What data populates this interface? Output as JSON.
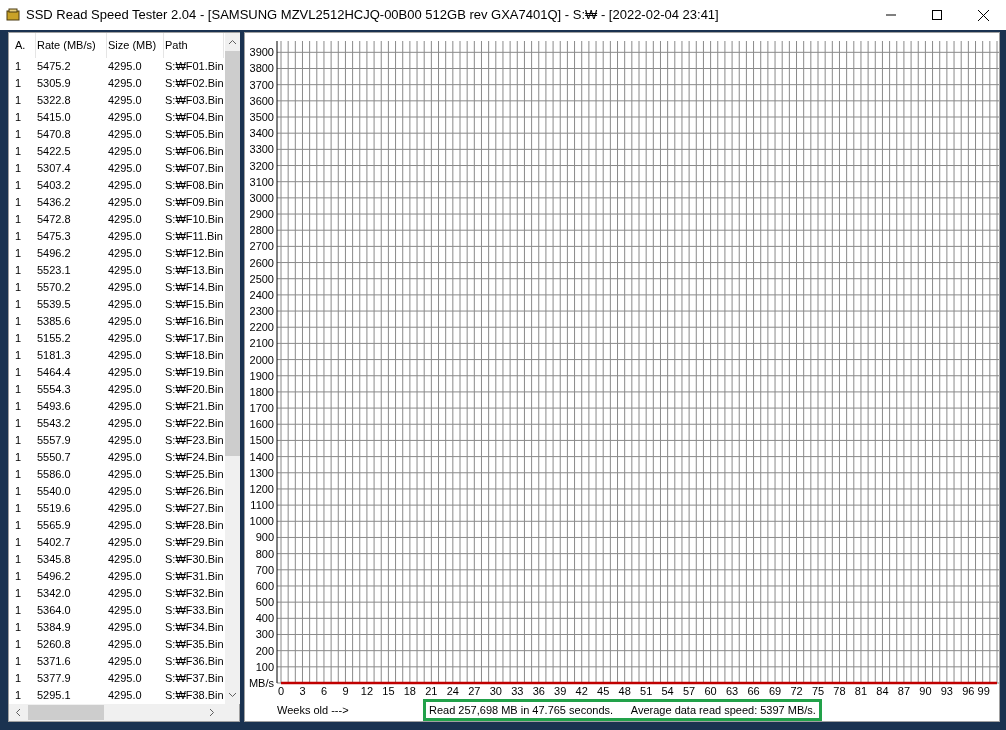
{
  "window": {
    "title": "SSD Read Speed Tester 2.04 - [SAMSUNG MZVL2512HCJQ-00B00 512GB rev GXA7401Q] - S:₩ - [2022-02-04 23:41]"
  },
  "table": {
    "columns": [
      "A.",
      "Rate (MB/s)",
      "Size (MB)",
      "Path"
    ],
    "rows": [
      [
        "1",
        "5475.2",
        "4295.0",
        "S:₩F01.Bin"
      ],
      [
        "1",
        "5305.9",
        "4295.0",
        "S:₩F02.Bin"
      ],
      [
        "1",
        "5322.8",
        "4295.0",
        "S:₩F03.Bin"
      ],
      [
        "1",
        "5415.0",
        "4295.0",
        "S:₩F04.Bin"
      ],
      [
        "1",
        "5470.8",
        "4295.0",
        "S:₩F05.Bin"
      ],
      [
        "1",
        "5422.5",
        "4295.0",
        "S:₩F06.Bin"
      ],
      [
        "1",
        "5307.4",
        "4295.0",
        "S:₩F07.Bin"
      ],
      [
        "1",
        "5403.2",
        "4295.0",
        "S:₩F08.Bin"
      ],
      [
        "1",
        "5436.2",
        "4295.0",
        "S:₩F09.Bin"
      ],
      [
        "1",
        "5472.8",
        "4295.0",
        "S:₩F10.Bin"
      ],
      [
        "1",
        "5475.3",
        "4295.0",
        "S:₩F11.Bin"
      ],
      [
        "1",
        "5496.2",
        "4295.0",
        "S:₩F12.Bin"
      ],
      [
        "1",
        "5523.1",
        "4295.0",
        "S:₩F13.Bin"
      ],
      [
        "1",
        "5570.2",
        "4295.0",
        "S:₩F14.Bin"
      ],
      [
        "1",
        "5539.5",
        "4295.0",
        "S:₩F15.Bin"
      ],
      [
        "1",
        "5385.6",
        "4295.0",
        "S:₩F16.Bin"
      ],
      [
        "1",
        "5155.2",
        "4295.0",
        "S:₩F17.Bin"
      ],
      [
        "1",
        "5181.3",
        "4295.0",
        "S:₩F18.Bin"
      ],
      [
        "1",
        "5464.4",
        "4295.0",
        "S:₩F19.Bin"
      ],
      [
        "1",
        "5554.3",
        "4295.0",
        "S:₩F20.Bin"
      ],
      [
        "1",
        "5493.6",
        "4295.0",
        "S:₩F21.Bin"
      ],
      [
        "1",
        "5543.2",
        "4295.0",
        "S:₩F22.Bin"
      ],
      [
        "1",
        "5557.9",
        "4295.0",
        "S:₩F23.Bin"
      ],
      [
        "1",
        "5550.7",
        "4295.0",
        "S:₩F24.Bin"
      ],
      [
        "1",
        "5586.0",
        "4295.0",
        "S:₩F25.Bin"
      ],
      [
        "1",
        "5540.0",
        "4295.0",
        "S:₩F26.Bin"
      ],
      [
        "1",
        "5519.6",
        "4295.0",
        "S:₩F27.Bin"
      ],
      [
        "1",
        "5565.9",
        "4295.0",
        "S:₩F28.Bin"
      ],
      [
        "1",
        "5402.7",
        "4295.0",
        "S:₩F29.Bin"
      ],
      [
        "1",
        "5345.8",
        "4295.0",
        "S:₩F30.Bin"
      ],
      [
        "1",
        "5496.2",
        "4295.0",
        "S:₩F31.Bin"
      ],
      [
        "1",
        "5342.0",
        "4295.0",
        "S:₩F32.Bin"
      ],
      [
        "1",
        "5364.0",
        "4295.0",
        "S:₩F33.Bin"
      ],
      [
        "1",
        "5384.9",
        "4295.0",
        "S:₩F34.Bin"
      ],
      [
        "1",
        "5260.8",
        "4295.0",
        "S:₩F35.Bin"
      ],
      [
        "1",
        "5371.6",
        "4295.0",
        "S:₩F36.Bin"
      ],
      [
        "1",
        "5377.9",
        "4295.0",
        "S:₩F37.Bin"
      ],
      [
        "1",
        "5295.1",
        "4295.0",
        "S:₩F38.Bin"
      ]
    ]
  },
  "chart": {
    "chart_data": {
      "type": "line",
      "xlabel": "Weeks old --->",
      "x": [
        0,
        100
      ],
      "grid": true,
      "series": [
        {
          "color": "#c00000",
          "values": [
            0,
            0
          ]
        }
      ],
      "xlim": [
        0,
        100
      ],
      "ylim": [
        0,
        3970
      ],
      "xticks": [
        0,
        3,
        6,
        9,
        12,
        15,
        18,
        21,
        24,
        27,
        30,
        33,
        36,
        39,
        42,
        45,
        48,
        51,
        54,
        57,
        60,
        63,
        66,
        69,
        72,
        75,
        78,
        81,
        84,
        87,
        90,
        93,
        96,
        99
      ],
      "yticks": [
        {
          "value": 0,
          "label": "MB/s"
        },
        100,
        200,
        300,
        400,
        500,
        600,
        700,
        800,
        900,
        1000,
        1100,
        1200,
        1300,
        1400,
        1500,
        1600,
        1700,
        1800,
        1900,
        2000,
        2100,
        2200,
        2300,
        2400,
        2500,
        2600,
        2700,
        2800,
        2900,
        3000,
        3100,
        3200,
        3300,
        3400,
        3500,
        3600,
        3700,
        3800,
        3900
      ]
    }
  },
  "status": "Read 257,698 MB in 47.765 seconds.      Average data read speed: 5397 MB/s."
}
